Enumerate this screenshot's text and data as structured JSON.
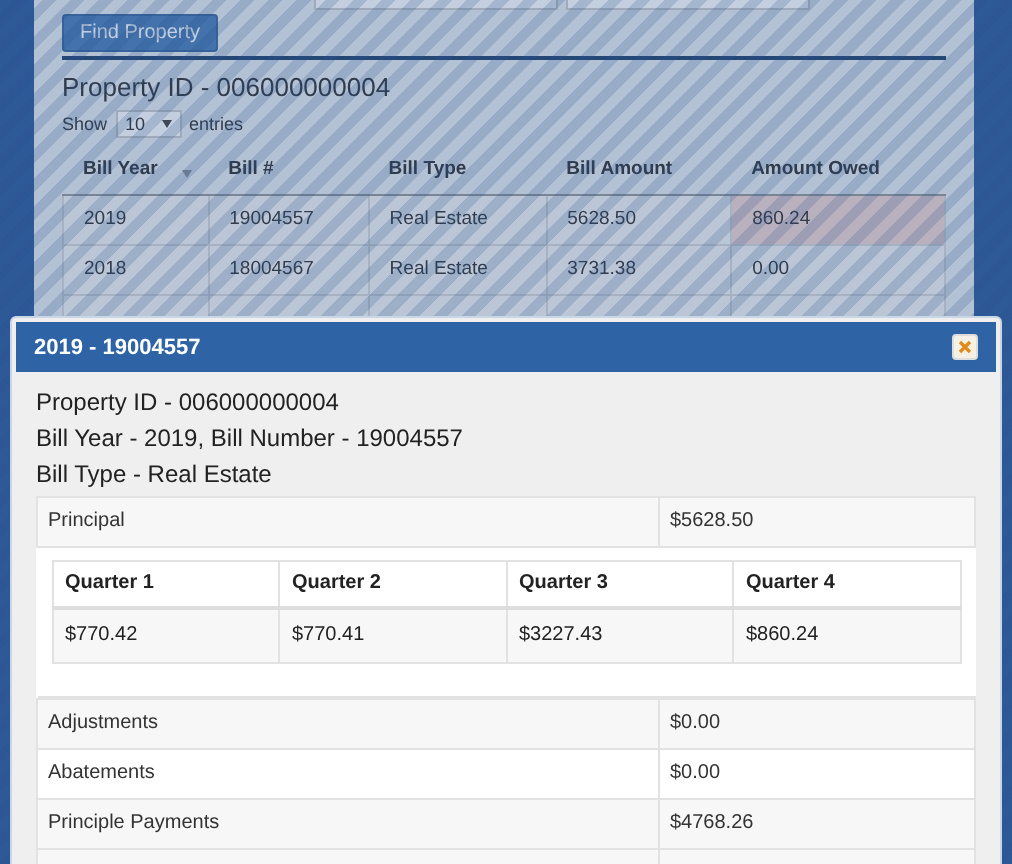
{
  "search": {
    "button": "Find Property"
  },
  "property": {
    "title": "Property ID - 006000000004",
    "show_label": "Show",
    "page_size": "10",
    "entries_label": "entries"
  },
  "bills": {
    "columns": [
      "Bill Year",
      "Bill #",
      "Bill Type",
      "Bill Amount",
      "Amount Owed"
    ],
    "rows": [
      {
        "cells": [
          "2019",
          "19004557",
          "Real Estate",
          "5628.50",
          "860.24"
        ],
        "owed_highlight": true
      },
      {
        "cells": [
          "2018",
          "18004567",
          "Real Estate",
          "3731.38",
          "0.00"
        ],
        "owed_highlight": false
      }
    ]
  },
  "dialog": {
    "title": "2019 - 19004557",
    "lines": [
      "Property ID - 006000000004",
      "Bill Year - 2019, Bill Number - 19004557",
      "Bill Type - Real Estate"
    ],
    "principal": {
      "label": "Principal",
      "value": "$5628.50"
    },
    "quarters": {
      "headers": [
        "Quarter 1",
        "Quarter 2",
        "Quarter 3",
        "Quarter 4"
      ],
      "values": [
        "$770.42",
        "$770.41",
        "$3227.43",
        "$860.24"
      ]
    },
    "details": [
      {
        "label": "Adjustments",
        "value": "$0.00"
      },
      {
        "label": "Abatements",
        "value": "$0.00"
      },
      {
        "label": "Principle Payments",
        "value": "$4768.26"
      }
    ]
  }
}
